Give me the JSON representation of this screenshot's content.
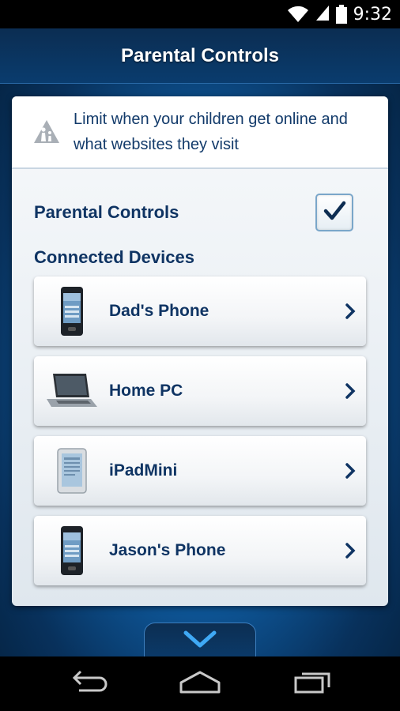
{
  "status_bar": {
    "time": "9:32"
  },
  "header": {
    "title": "Parental Controls"
  },
  "notice": {
    "text": "Limit when your children get online and what websites they visit"
  },
  "parental_controls": {
    "label": "Parental Controls",
    "enabled": true
  },
  "devices_section": {
    "title": "Connected Devices"
  },
  "devices": [
    {
      "name": "Dad's Phone",
      "type": "phone-icon"
    },
    {
      "name": "Home PC",
      "type": "laptop-icon"
    },
    {
      "name": "iPadMini",
      "type": "tablet-icon"
    },
    {
      "name": "Jason's Phone",
      "type": "phone-icon"
    }
  ],
  "colors": {
    "header_bg": "#0b2d52",
    "text_dark": "#0f3463",
    "accent_blue": "#0f5fa6"
  }
}
